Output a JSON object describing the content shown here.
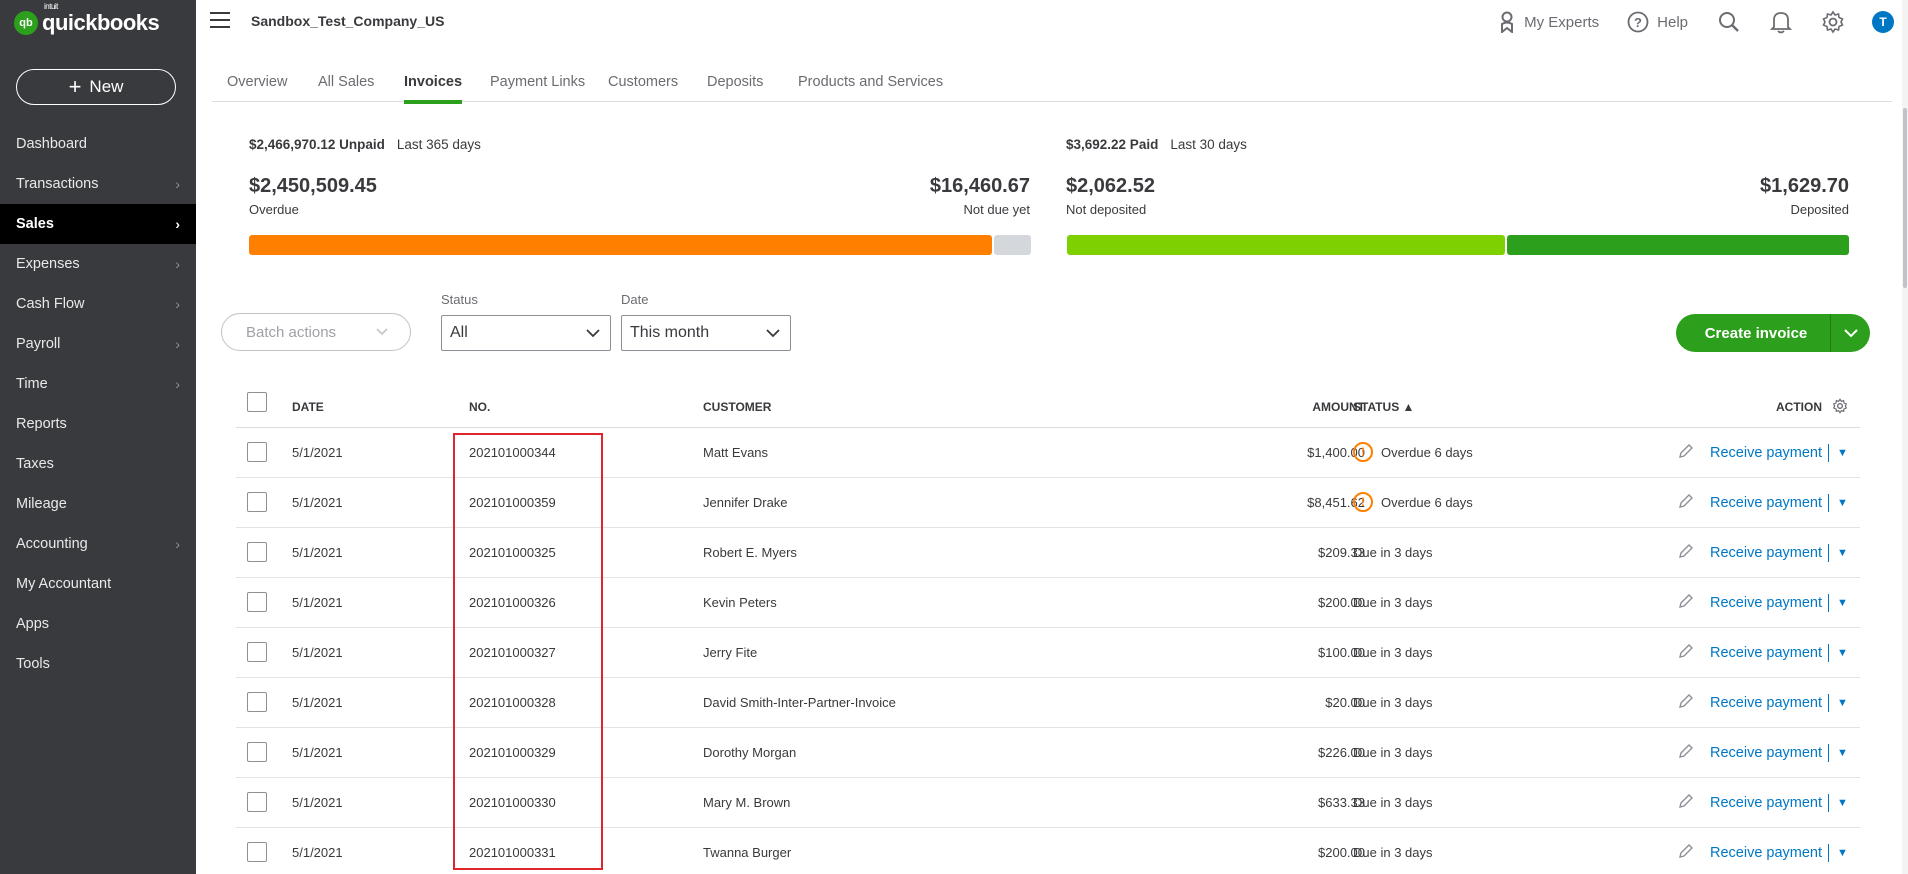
{
  "app": {
    "logo_top": "intuit",
    "logo_name": "quickbooks",
    "logo_mark": "qb",
    "company": "Sandbox_Test_Company_US"
  },
  "sidebar": {
    "new_label": "New",
    "items": [
      {
        "label": "Dashboard",
        "chevron": false
      },
      {
        "label": "Transactions",
        "chevron": true
      },
      {
        "label": "Sales",
        "chevron": true,
        "active": true
      },
      {
        "label": "Expenses",
        "chevron": true
      },
      {
        "label": "Cash Flow",
        "chevron": true
      },
      {
        "label": "Payroll",
        "chevron": true
      },
      {
        "label": "Time",
        "chevron": true
      },
      {
        "label": "Reports",
        "chevron": false
      },
      {
        "label": "Taxes",
        "chevron": false
      },
      {
        "label": "Mileage",
        "chevron": false
      },
      {
        "label": "Accounting",
        "chevron": true
      },
      {
        "label": "My Accountant",
        "chevron": false
      },
      {
        "label": "Apps",
        "chevron": false
      },
      {
        "label": "Tools",
        "chevron": false
      }
    ]
  },
  "header": {
    "my_experts": "My Experts",
    "help": "Help",
    "avatar_initial": "T"
  },
  "tabs": [
    "Overview",
    "All Sales",
    "Invoices",
    "Payment Links",
    "Customers",
    "Deposits",
    "Products and Services"
  ],
  "active_tab": "Invoices",
  "summary": {
    "unpaid": {
      "total": "$2,466,970.12 Unpaid",
      "period": "Last 365 days",
      "overdue_amount": "$2,450,509.45",
      "overdue_label": "Overdue",
      "notdue_amount": "$16,460.67",
      "notdue_label": "Not due yet",
      "overdue_fraction": 0.95
    },
    "paid": {
      "total": "$3,692.22 Paid",
      "period": "Last 30 days",
      "notdeposited_amount": "$2,062.52",
      "notdeposited_label": "Not deposited",
      "deposited_amount": "$1,629.70",
      "deposited_label": "Deposited",
      "notdeposited_fraction": 0.56
    }
  },
  "filters": {
    "batch_actions": "Batch actions",
    "status_label": "Status",
    "status_value": "All",
    "date_label": "Date",
    "date_value": "This month",
    "create_invoice": "Create invoice"
  },
  "table": {
    "headers": {
      "date": "DATE",
      "no": "NO.",
      "customer": "CUSTOMER",
      "amount": "AMOUNT",
      "status": "STATUS ▲",
      "action": "ACTION"
    },
    "action_label": "Receive payment",
    "rows": [
      {
        "date": "5/1/2021",
        "no": "202101000344",
        "customer": "Matt Evans",
        "amount": "$1,400.00",
        "status": "Overdue 6 days",
        "overdue": true
      },
      {
        "date": "5/1/2021",
        "no": "202101000359",
        "customer": "Jennifer Drake",
        "amount": "$8,451.62",
        "status": "Overdue 6 days",
        "overdue": true
      },
      {
        "date": "5/1/2021",
        "no": "202101000325",
        "customer": "Robert E. Myers",
        "amount": "$209.33",
        "status": "Due in 3 days",
        "overdue": false
      },
      {
        "date": "5/1/2021",
        "no": "202101000326",
        "customer": "Kevin Peters",
        "amount": "$200.00",
        "status": "Due in 3 days",
        "overdue": false
      },
      {
        "date": "5/1/2021",
        "no": "202101000327",
        "customer": "Jerry Fite",
        "amount": "$100.00",
        "status": "Due in 3 days",
        "overdue": false
      },
      {
        "date": "5/1/2021",
        "no": "202101000328",
        "customer": "David Smith-Inter-Partner-Invoice",
        "amount": "$20.00",
        "status": "Due in 3 days",
        "overdue": false
      },
      {
        "date": "5/1/2021",
        "no": "202101000329",
        "customer": "Dorothy Morgan",
        "amount": "$226.00",
        "status": "Due in 3 days",
        "overdue": false
      },
      {
        "date": "5/1/2021",
        "no": "202101000330",
        "customer": "Mary M. Brown",
        "amount": "$633.33",
        "status": "Due in 3 days",
        "overdue": false
      },
      {
        "date": "5/1/2021",
        "no": "202101000331",
        "customer": "Twanna Burger",
        "amount": "$200.00",
        "status": "Due in 3 days",
        "overdue": false
      }
    ]
  },
  "colors": {
    "brand_green": "#2ca01c",
    "overdue_orange": "#ff8000",
    "link_blue": "#0077c5",
    "sidebar_bg": "#393a3d",
    "highlight_red": "#e0262b",
    "notdeposited_green": "#7fd000",
    "deposited_green": "#2ca01c"
  }
}
